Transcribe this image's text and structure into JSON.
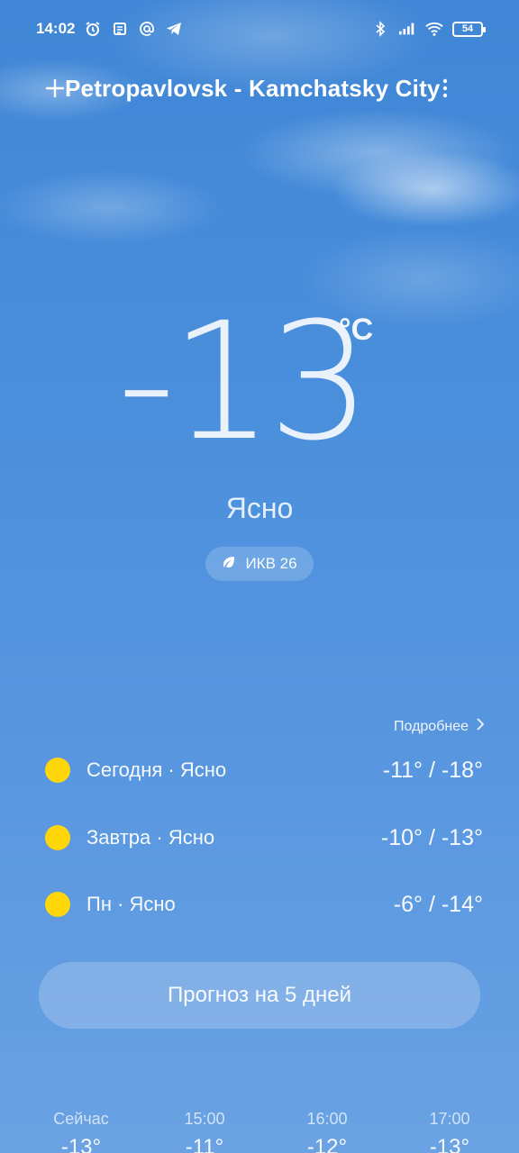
{
  "status_bar": {
    "time": "14:02",
    "left_icons": [
      "alarm-icon",
      "news-icon",
      "at-sign-icon",
      "telegram-icon"
    ],
    "right_icons": [
      "bluetooth-icon",
      "signal-icon",
      "wifi-icon"
    ],
    "battery": "54"
  },
  "header": {
    "city": "Petropavlovsk - Kamchatsky City",
    "add_icon": "plus-icon",
    "more_icon": "more-vertical-icon"
  },
  "current": {
    "temperature": "-13",
    "unit": "°C",
    "condition": "Ясно",
    "aqi_label": "ИКВ 26",
    "aqi_icon": "leaf-icon"
  },
  "forecast": {
    "more_label": "Подробнее",
    "days": [
      {
        "label": "Сегодня · Ясно",
        "temps": "-11° / -18°",
        "icon": "sun-icon"
      },
      {
        "label": "Завтра · Ясно",
        "temps": "-10° / -13°",
        "icon": "sun-icon"
      },
      {
        "label": "Пн · Ясно",
        "temps": "-6° / -14°",
        "icon": "sun-icon"
      }
    ],
    "five_day_button": "Прогноз на 5 дней"
  },
  "hourly": [
    {
      "time": "Сейчас",
      "temp": "-13°"
    },
    {
      "time": "15:00",
      "temp": "-11°"
    },
    {
      "time": "16:00",
      "temp": "-12°"
    },
    {
      "time": "17:00",
      "temp": "-13°"
    }
  ],
  "colors": {
    "sun": "#ffd60a",
    "background_top": "#3f86d6",
    "background_bottom": "#6aa2e3"
  }
}
